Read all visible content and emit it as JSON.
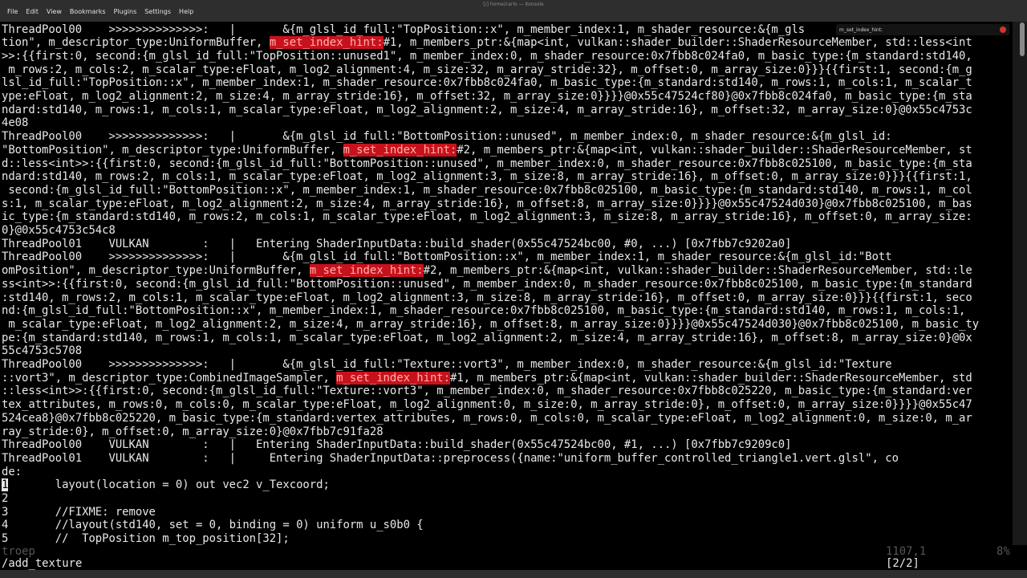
{
  "window": {
    "title": "[/] home/carlo — Konsole",
    "menu": [
      "File",
      "Edit",
      "View",
      "Bookmarks",
      "Plugins",
      "Settings",
      "Help"
    ]
  },
  "search": {
    "text": "m_set_index_hint:"
  },
  "terminal": {
    "lines": [
      [
        {
          "t": "ThreadPool00    >>>>>>>>>>>>>>:   |       &{m_glsl_id_full:\"TopPosition::x\", m_member_index:1, m_shader_resource:&{m_gls"
        }
      ],
      [
        {
          "t": "tion\", m_descriptor_type:UniformBuffer, "
        },
        {
          "t": "m_set_index_hint:",
          "h": 1
        },
        {
          "t": "#1, m_members_ptr:&{map<int, vulkan::shader_builder::ShaderResourceMember, std::less<int"
        }
      ],
      [
        {
          "t": ">>:{{first:0, second:{m_glsl_id_full:\"TopPosition::unused1\", m_member_index:0, m_shader_resource:0x7fbb8c024fa0, m_basic_type:{m_standard:std140,"
        }
      ],
      [
        {
          "t": " m_rows:2, m_cols:2, m_scalar_type:eFloat, m_log2_alignment:4, m_size:32, m_array_stride:32}, m_offset:0, m_array_size:0}}}{{first:1, second:{m_g"
        }
      ],
      [
        {
          "t": "lsl_id_full:\"TopPosition::x\", m_member_index:1, m_shader_resource:0x7fbb8c024fa0, m_basic_type:{m_standard:std140, m_rows:1, m_cols:1, m_scalar_t"
        }
      ],
      [
        {
          "t": "ype:eFloat, m_log2_alignment:2, m_size:4, m_array_stride:16}, m_offset:32, m_array_size:0}}}}@0x55c47524cf80}@0x7fbb8c024fa0, m_basic_type:{m_sta"
        }
      ],
      [
        {
          "t": "ndard:std140, m_rows:1, m_cols:1, m_scalar_type:eFloat, m_log2_alignment:2, m_size:4, m_array_stride:16}, m_offset:32, m_array_size:0}@0x55c4753c"
        }
      ],
      [
        {
          "t": "4e08"
        }
      ],
      [
        {
          "t": "ThreadPool00    >>>>>>>>>>>>>>:   |       &{m_glsl_id_full:\"BottomPosition::unused\", m_member_index:0, m_shader_resource:&{m_glsl_id:"
        }
      ],
      [
        {
          "t": "\"BottomPosition\", m_descriptor_type:UniformBuffer, "
        },
        {
          "t": "m_set_index_hint:",
          "h": 1
        },
        {
          "t": "#2, m_members_ptr:&{map<int, vulkan::shader_builder::ShaderResourceMember, st"
        }
      ],
      [
        {
          "t": "d::less<int>>:{{first:0, second:{m_glsl_id_full:\"BottomPosition::unused\", m_member_index:0, m_shader_resource:0x7fbb8c025100, m_basic_type:{m_sta"
        }
      ],
      [
        {
          "t": "ndard:std140, m_rows:2, m_cols:1, m_scalar_type:eFloat, m_log2_alignment:3, m_size:8, m_array_stride:16}, m_offset:0, m_array_size:0}}}{{first:1,"
        }
      ],
      [
        {
          "t": " second:{m_glsl_id_full:\"BottomPosition::x\", m_member_index:1, m_shader_resource:0x7fbb8c025100, m_basic_type:{m_standard:std140, m_rows:1, m_col"
        }
      ],
      [
        {
          "t": "s:1, m_scalar_type:eFloat, m_log2_alignment:2, m_size:4, m_array_stride:16}, m_offset:8, m_array_size:0}}}}@0x55c47524d030}@0x7fbb8c025100, m_bas"
        }
      ],
      [
        {
          "t": "ic_type:{m_standard:std140, m_rows:2, m_cols:1, m_scalar_type:eFloat, m_log2_alignment:3, m_size:8, m_array_stride:16}, m_offset:0, m_array_size:"
        }
      ],
      [
        {
          "t": "0}@0x55c4753c54c8"
        }
      ],
      [
        {
          "t": "ThreadPool01    VULKAN        :   |   Entering ShaderInputData::build_shader(0x55c47524bc00, #0, ...) [0x7fbb7c9202a0]"
        }
      ],
      [
        {
          "t": "ThreadPool00    >>>>>>>>>>>>>>:   |       &{m_glsl_id_full:\"BottomPosition::x\", m_member_index:1, m_shader_resource:&{m_glsl_id:\"Bott"
        }
      ],
      [
        {
          "t": "omPosition\", m_descriptor_type:UniformBuffer, "
        },
        {
          "t": "m_set_index_hint:",
          "h": 1
        },
        {
          "t": "#2, m_members_ptr:&{map<int, vulkan::shader_builder::ShaderResourceMember, std::le"
        }
      ],
      [
        {
          "t": "ss<int>>:{{first:0, second:{m_glsl_id_full:\"BottomPosition::unused\", m_member_index:0, m_shader_resource:0x7fbb8c025100, m_basic_type:{m_standard"
        }
      ],
      [
        {
          "t": ":std140, m_rows:2, m_cols:1, m_scalar_type:eFloat, m_log2_alignment:3, m_size:8, m_array_stride:16}, m_offset:0, m_array_size:0}}}{{first:1, seco"
        }
      ],
      [
        {
          "t": "nd:{m_glsl_id_full:\"BottomPosition::x\", m_member_index:1, m_shader_resource:0x7fbb8c025100, m_basic_type:{m_standard:std140, m_rows:1, m_cols:1,"
        }
      ],
      [
        {
          "t": " m_scalar_type:eFloat, m_log2_alignment:2, m_size:4, m_array_stride:16}, m_offset:8, m_array_size:0}}}}@0x55c47524d030}@0x7fbb8c025100, m_basic_ty"
        }
      ],
      [
        {
          "t": "pe:{m_standard:std140, m_rows:1, m_cols:1, m_scalar_type:eFloat, m_log2_alignment:2, m_size:4, m_array_stride:16}, m_offset:8, m_array_size:0}@0x"
        }
      ],
      [
        {
          "t": "55c4753c5708"
        }
      ],
      [
        {
          "t": "ThreadPool00    >>>>>>>>>>>>>>:   |       &{m_glsl_id_full:\"Texture::vort3\", m_member_index:0, m_shader_resource:&{m_glsl_id:\"Texture"
        }
      ],
      [
        {
          "t": "::vort3\", m_descriptor_type:CombinedImageSampler, "
        },
        {
          "t": "m_set_index_hint:",
          "h": 1
        },
        {
          "t": "#1, m_members_ptr:&{map<int, vulkan::shader_builder::ShaderResourceMember, std"
        }
      ],
      [
        {
          "t": "::less<int>>:{{first:0, second:{m_glsl_id_full:\"Texture::vort3\", m_member_index:0, m_shader_resource:0x7fbb8c025220, m_basic_type:{m_standard:ver"
        }
      ],
      [
        {
          "t": "tex_attributes, m_rows:0, m_cols:0, m_scalar_type:eFloat, m_log2_alignment:0, m_size:0, m_array_stride:0}, m_offset:0, m_array_size:0}}}}@0x55c47"
        }
      ],
      [
        {
          "t": "524cea8}@0x7fbb8c025220, m_basic_type:{m_standard:vertex_attributes, m_rows:0, m_cols:0, m_scalar_type:eFloat, m_log2_alignment:0, m_size:0, m_ar"
        }
      ],
      [
        {
          "t": "ray_stride:0}, m_offset:0, m_array_size:0}@0x7fbb7c91fa28"
        }
      ],
      [
        {
          "t": "ThreadPool00    VULKAN        :   |   Entering ShaderInputData::build_shader(0x55c47524bc00, #1, ...) [0x7fbb7c9209c0]"
        }
      ],
      [
        {
          "t": "ThreadPool01    VULKAN        :   |     Entering ShaderInputData::preprocess({name:\"uniform_buffer_controlled_triangle1.vert.glsl\", co"
        }
      ],
      [
        {
          "t": "de:"
        }
      ],
      [
        {
          "t": "1",
          "c": 1
        },
        {
          "t": "       layout(location = 0) out vec2 v_Texcoord;"
        }
      ],
      [
        {
          "t": "2"
        }
      ],
      [
        {
          "t": "3       //FIXME: remove"
        }
      ],
      [
        {
          "t": "4       //layout(std140, set = 0, binding = 0) uniform u_s0b0 {"
        }
      ],
      [
        {
          "t": "5       //  TopPosition m_top_position[32];"
        }
      ]
    ]
  },
  "status": {
    "left": "troep",
    "position": "1107,1",
    "percent": "8%"
  },
  "command": {
    "text": "/add_texture",
    "count": "[2/2]"
  }
}
